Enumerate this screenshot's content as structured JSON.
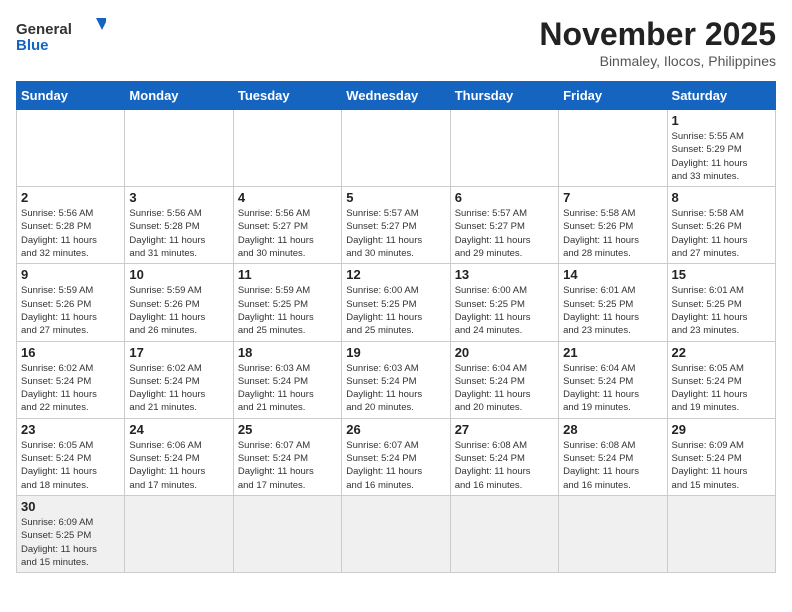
{
  "header": {
    "logo_general": "General",
    "logo_blue": "Blue",
    "month_year": "November 2025",
    "location": "Binmaley, Ilocos, Philippines"
  },
  "days_of_week": [
    "Sunday",
    "Monday",
    "Tuesday",
    "Wednesday",
    "Thursday",
    "Friday",
    "Saturday"
  ],
  "weeks": [
    [
      {
        "day": "",
        "info": ""
      },
      {
        "day": "",
        "info": ""
      },
      {
        "day": "",
        "info": ""
      },
      {
        "day": "",
        "info": ""
      },
      {
        "day": "",
        "info": ""
      },
      {
        "day": "",
        "info": ""
      },
      {
        "day": "1",
        "info": "Sunrise: 5:55 AM\nSunset: 5:29 PM\nDaylight: 11 hours\nand 33 minutes."
      }
    ],
    [
      {
        "day": "2",
        "info": "Sunrise: 5:56 AM\nSunset: 5:28 PM\nDaylight: 11 hours\nand 32 minutes."
      },
      {
        "day": "3",
        "info": "Sunrise: 5:56 AM\nSunset: 5:28 PM\nDaylight: 11 hours\nand 31 minutes."
      },
      {
        "day": "4",
        "info": "Sunrise: 5:56 AM\nSunset: 5:27 PM\nDaylight: 11 hours\nand 30 minutes."
      },
      {
        "day": "5",
        "info": "Sunrise: 5:57 AM\nSunset: 5:27 PM\nDaylight: 11 hours\nand 30 minutes."
      },
      {
        "day": "6",
        "info": "Sunrise: 5:57 AM\nSunset: 5:27 PM\nDaylight: 11 hours\nand 29 minutes."
      },
      {
        "day": "7",
        "info": "Sunrise: 5:58 AM\nSunset: 5:26 PM\nDaylight: 11 hours\nand 28 minutes."
      },
      {
        "day": "8",
        "info": "Sunrise: 5:58 AM\nSunset: 5:26 PM\nDaylight: 11 hours\nand 27 minutes."
      }
    ],
    [
      {
        "day": "9",
        "info": "Sunrise: 5:59 AM\nSunset: 5:26 PM\nDaylight: 11 hours\nand 27 minutes."
      },
      {
        "day": "10",
        "info": "Sunrise: 5:59 AM\nSunset: 5:26 PM\nDaylight: 11 hours\nand 26 minutes."
      },
      {
        "day": "11",
        "info": "Sunrise: 5:59 AM\nSunset: 5:25 PM\nDaylight: 11 hours\nand 25 minutes."
      },
      {
        "day": "12",
        "info": "Sunrise: 6:00 AM\nSunset: 5:25 PM\nDaylight: 11 hours\nand 25 minutes."
      },
      {
        "day": "13",
        "info": "Sunrise: 6:00 AM\nSunset: 5:25 PM\nDaylight: 11 hours\nand 24 minutes."
      },
      {
        "day": "14",
        "info": "Sunrise: 6:01 AM\nSunset: 5:25 PM\nDaylight: 11 hours\nand 23 minutes."
      },
      {
        "day": "15",
        "info": "Sunrise: 6:01 AM\nSunset: 5:25 PM\nDaylight: 11 hours\nand 23 minutes."
      }
    ],
    [
      {
        "day": "16",
        "info": "Sunrise: 6:02 AM\nSunset: 5:24 PM\nDaylight: 11 hours\nand 22 minutes."
      },
      {
        "day": "17",
        "info": "Sunrise: 6:02 AM\nSunset: 5:24 PM\nDaylight: 11 hours\nand 21 minutes."
      },
      {
        "day": "18",
        "info": "Sunrise: 6:03 AM\nSunset: 5:24 PM\nDaylight: 11 hours\nand 21 minutes."
      },
      {
        "day": "19",
        "info": "Sunrise: 6:03 AM\nSunset: 5:24 PM\nDaylight: 11 hours\nand 20 minutes."
      },
      {
        "day": "20",
        "info": "Sunrise: 6:04 AM\nSunset: 5:24 PM\nDaylight: 11 hours\nand 20 minutes."
      },
      {
        "day": "21",
        "info": "Sunrise: 6:04 AM\nSunset: 5:24 PM\nDaylight: 11 hours\nand 19 minutes."
      },
      {
        "day": "22",
        "info": "Sunrise: 6:05 AM\nSunset: 5:24 PM\nDaylight: 11 hours\nand 19 minutes."
      }
    ],
    [
      {
        "day": "23",
        "info": "Sunrise: 6:05 AM\nSunset: 5:24 PM\nDaylight: 11 hours\nand 18 minutes."
      },
      {
        "day": "24",
        "info": "Sunrise: 6:06 AM\nSunset: 5:24 PM\nDaylight: 11 hours\nand 17 minutes."
      },
      {
        "day": "25",
        "info": "Sunrise: 6:07 AM\nSunset: 5:24 PM\nDaylight: 11 hours\nand 17 minutes."
      },
      {
        "day": "26",
        "info": "Sunrise: 6:07 AM\nSunset: 5:24 PM\nDaylight: 11 hours\nand 16 minutes."
      },
      {
        "day": "27",
        "info": "Sunrise: 6:08 AM\nSunset: 5:24 PM\nDaylight: 11 hours\nand 16 minutes."
      },
      {
        "day": "28",
        "info": "Sunrise: 6:08 AM\nSunset: 5:24 PM\nDaylight: 11 hours\nand 16 minutes."
      },
      {
        "day": "29",
        "info": "Sunrise: 6:09 AM\nSunset: 5:24 PM\nDaylight: 11 hours\nand 15 minutes."
      }
    ],
    [
      {
        "day": "30",
        "info": "Sunrise: 6:09 AM\nSunset: 5:25 PM\nDaylight: 11 hours\nand 15 minutes."
      },
      {
        "day": "",
        "info": ""
      },
      {
        "day": "",
        "info": ""
      },
      {
        "day": "",
        "info": ""
      },
      {
        "day": "",
        "info": ""
      },
      {
        "day": "",
        "info": ""
      },
      {
        "day": "",
        "info": ""
      }
    ]
  ]
}
